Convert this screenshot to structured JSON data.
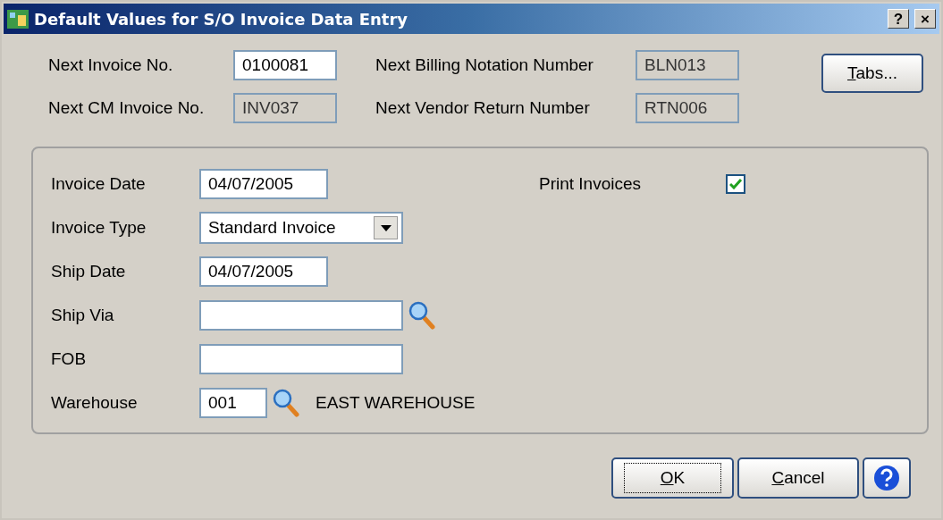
{
  "window": {
    "title": "Default Values for S/O Invoice Data Entry",
    "title_buttons": [
      "?",
      "×"
    ]
  },
  "header_fields": [
    {
      "label": "Next Invoice No.",
      "value": "0100081",
      "disabled": false
    },
    {
      "label": "Next Billing Notation Number",
      "value": "BLN013",
      "disabled": true
    },
    {
      "label": "Next CM Invoice No.",
      "value": "INV037",
      "disabled": true
    },
    {
      "label": "Next Vendor Return Number",
      "value": "RTN006",
      "disabled": true
    }
  ],
  "tabs_button": "Tabs...",
  "form": [
    {
      "kind": "date",
      "label": "Invoice Date",
      "value": "04/07/2005"
    },
    {
      "kind": "combo",
      "label": "Invoice Type",
      "value": "Standard Invoice"
    },
    {
      "kind": "date",
      "label": "Ship Date",
      "value": "04/07/2005"
    },
    {
      "kind": "lookup",
      "label": "Ship Via"
    },
    {
      "kind": "text",
      "label": "FOB"
    },
    {
      "kind": "lookup_small",
      "label": "Warehouse",
      "value": "001",
      "description": "EAST WAREHOUSE"
    }
  ],
  "print_invoices": {
    "label": "Print Invoices",
    "checked": true
  },
  "buttons": [
    {
      "kind": "default",
      "label": "OK"
    },
    {
      "kind": "normal",
      "label": "Cancel"
    },
    {
      "kind": "help"
    }
  ]
}
